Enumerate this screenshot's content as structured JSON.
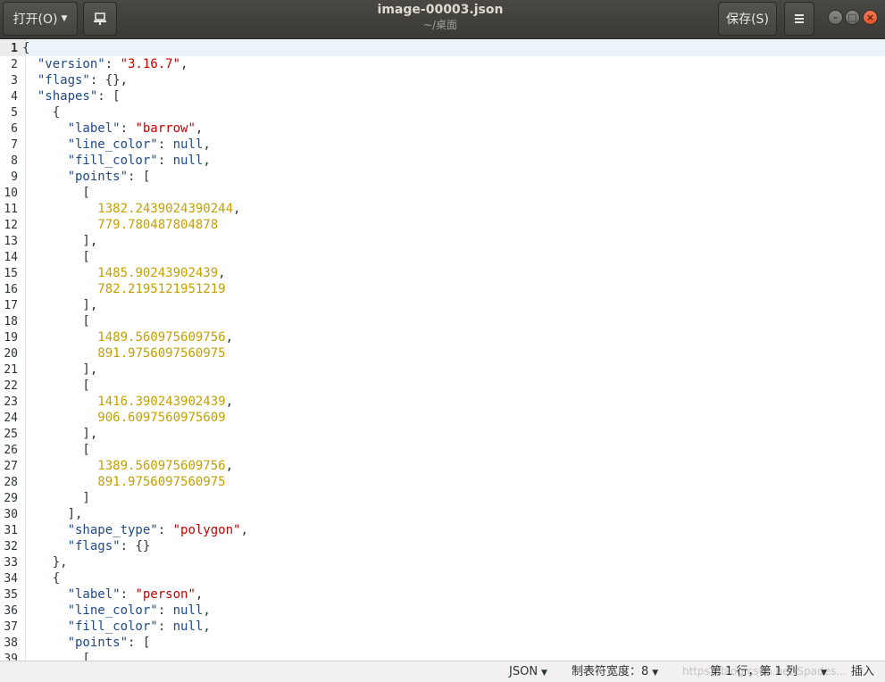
{
  "headerbar": {
    "open_label": "打开(O)",
    "title": "image-00003.json",
    "subtitle": "~/桌面",
    "save_label": "保存(S)",
    "icons": {
      "pin": "pin-icon",
      "menu": "hamburger-menu-icon",
      "minimize": "minimize-icon",
      "maximize": "maximize-icon",
      "close": "close-icon"
    }
  },
  "editor": {
    "current_line": 1,
    "lines": [
      [
        [
          "p",
          "{"
        ]
      ],
      [
        [
          "p",
          "  "
        ],
        [
          "k",
          "\"version\""
        ],
        [
          "p",
          ": "
        ],
        [
          "s",
          "\"3.16.7\""
        ],
        [
          "p",
          ","
        ]
      ],
      [
        [
          "p",
          "  "
        ],
        [
          "k",
          "\"flags\""
        ],
        [
          "p",
          ": {},"
        ]
      ],
      [
        [
          "p",
          "  "
        ],
        [
          "k",
          "\"shapes\""
        ],
        [
          "p",
          ": ["
        ]
      ],
      [
        [
          "p",
          "    {"
        ]
      ],
      [
        [
          "p",
          "      "
        ],
        [
          "k",
          "\"label\""
        ],
        [
          "p",
          ": "
        ],
        [
          "s",
          "\"barrow\""
        ],
        [
          "p",
          ","
        ]
      ],
      [
        [
          "p",
          "      "
        ],
        [
          "k",
          "\"line_color\""
        ],
        [
          "p",
          ": "
        ],
        [
          "k",
          "null"
        ],
        [
          "p",
          ","
        ]
      ],
      [
        [
          "p",
          "      "
        ],
        [
          "k",
          "\"fill_color\""
        ],
        [
          "p",
          ": "
        ],
        [
          "k",
          "null"
        ],
        [
          "p",
          ","
        ]
      ],
      [
        [
          "p",
          "      "
        ],
        [
          "k",
          "\"points\""
        ],
        [
          "p",
          ": ["
        ]
      ],
      [
        [
          "p",
          "        ["
        ]
      ],
      [
        [
          "p",
          "          "
        ],
        [
          "n",
          "1382.2439024390244"
        ],
        [
          "p",
          ","
        ]
      ],
      [
        [
          "p",
          "          "
        ],
        [
          "n",
          "779.780487804878"
        ]
      ],
      [
        [
          "p",
          "        ],"
        ]
      ],
      [
        [
          "p",
          "        ["
        ]
      ],
      [
        [
          "p",
          "          "
        ],
        [
          "n",
          "1485.90243902439"
        ],
        [
          "p",
          ","
        ]
      ],
      [
        [
          "p",
          "          "
        ],
        [
          "n",
          "782.2195121951219"
        ]
      ],
      [
        [
          "p",
          "        ],"
        ]
      ],
      [
        [
          "p",
          "        ["
        ]
      ],
      [
        [
          "p",
          "          "
        ],
        [
          "n",
          "1489.560975609756"
        ],
        [
          "p",
          ","
        ]
      ],
      [
        [
          "p",
          "          "
        ],
        [
          "n",
          "891.9756097560975"
        ]
      ],
      [
        [
          "p",
          "        ],"
        ]
      ],
      [
        [
          "p",
          "        ["
        ]
      ],
      [
        [
          "p",
          "          "
        ],
        [
          "n",
          "1416.390243902439"
        ],
        [
          "p",
          ","
        ]
      ],
      [
        [
          "p",
          "          "
        ],
        [
          "n",
          "906.6097560975609"
        ]
      ],
      [
        [
          "p",
          "        ],"
        ]
      ],
      [
        [
          "p",
          "        ["
        ]
      ],
      [
        [
          "p",
          "          "
        ],
        [
          "n",
          "1389.560975609756"
        ],
        [
          "p",
          ","
        ]
      ],
      [
        [
          "p",
          "          "
        ],
        [
          "n",
          "891.9756097560975"
        ]
      ],
      [
        [
          "p",
          "        ]"
        ]
      ],
      [
        [
          "p",
          "      ],"
        ]
      ],
      [
        [
          "p",
          "      "
        ],
        [
          "k",
          "\"shape_type\""
        ],
        [
          "p",
          ": "
        ],
        [
          "s",
          "\"polygon\""
        ],
        [
          "p",
          ","
        ]
      ],
      [
        [
          "p",
          "      "
        ],
        [
          "k",
          "\"flags\""
        ],
        [
          "p",
          ": {}"
        ]
      ],
      [
        [
          "p",
          "    },"
        ]
      ],
      [
        [
          "p",
          "    {"
        ]
      ],
      [
        [
          "p",
          "      "
        ],
        [
          "k",
          "\"label\""
        ],
        [
          "p",
          ": "
        ],
        [
          "s",
          "\"person\""
        ],
        [
          "p",
          ","
        ]
      ],
      [
        [
          "p",
          "      "
        ],
        [
          "k",
          "\"line_color\""
        ],
        [
          "p",
          ": "
        ],
        [
          "k",
          "null"
        ],
        [
          "p",
          ","
        ]
      ],
      [
        [
          "p",
          "      "
        ],
        [
          "k",
          "\"fill_color\""
        ],
        [
          "p",
          ": "
        ],
        [
          "k",
          "null"
        ],
        [
          "p",
          ","
        ]
      ],
      [
        [
          "p",
          "      "
        ],
        [
          "k",
          "\"points\""
        ],
        [
          "p",
          ": ["
        ]
      ],
      [
        [
          "p",
          "        ["
        ]
      ]
    ]
  },
  "statusbar": {
    "language": "JSON",
    "tab_width": "制表符宽度：8",
    "position": "第 1 行，第 1 列",
    "mode": "插入",
    "watermark": "https://blog.csdn.net/Spades..."
  },
  "colors": {
    "key": "#204a87",
    "string": "#cc0000",
    "number": "#c4a000",
    "headerbar": "#3e3d39"
  }
}
